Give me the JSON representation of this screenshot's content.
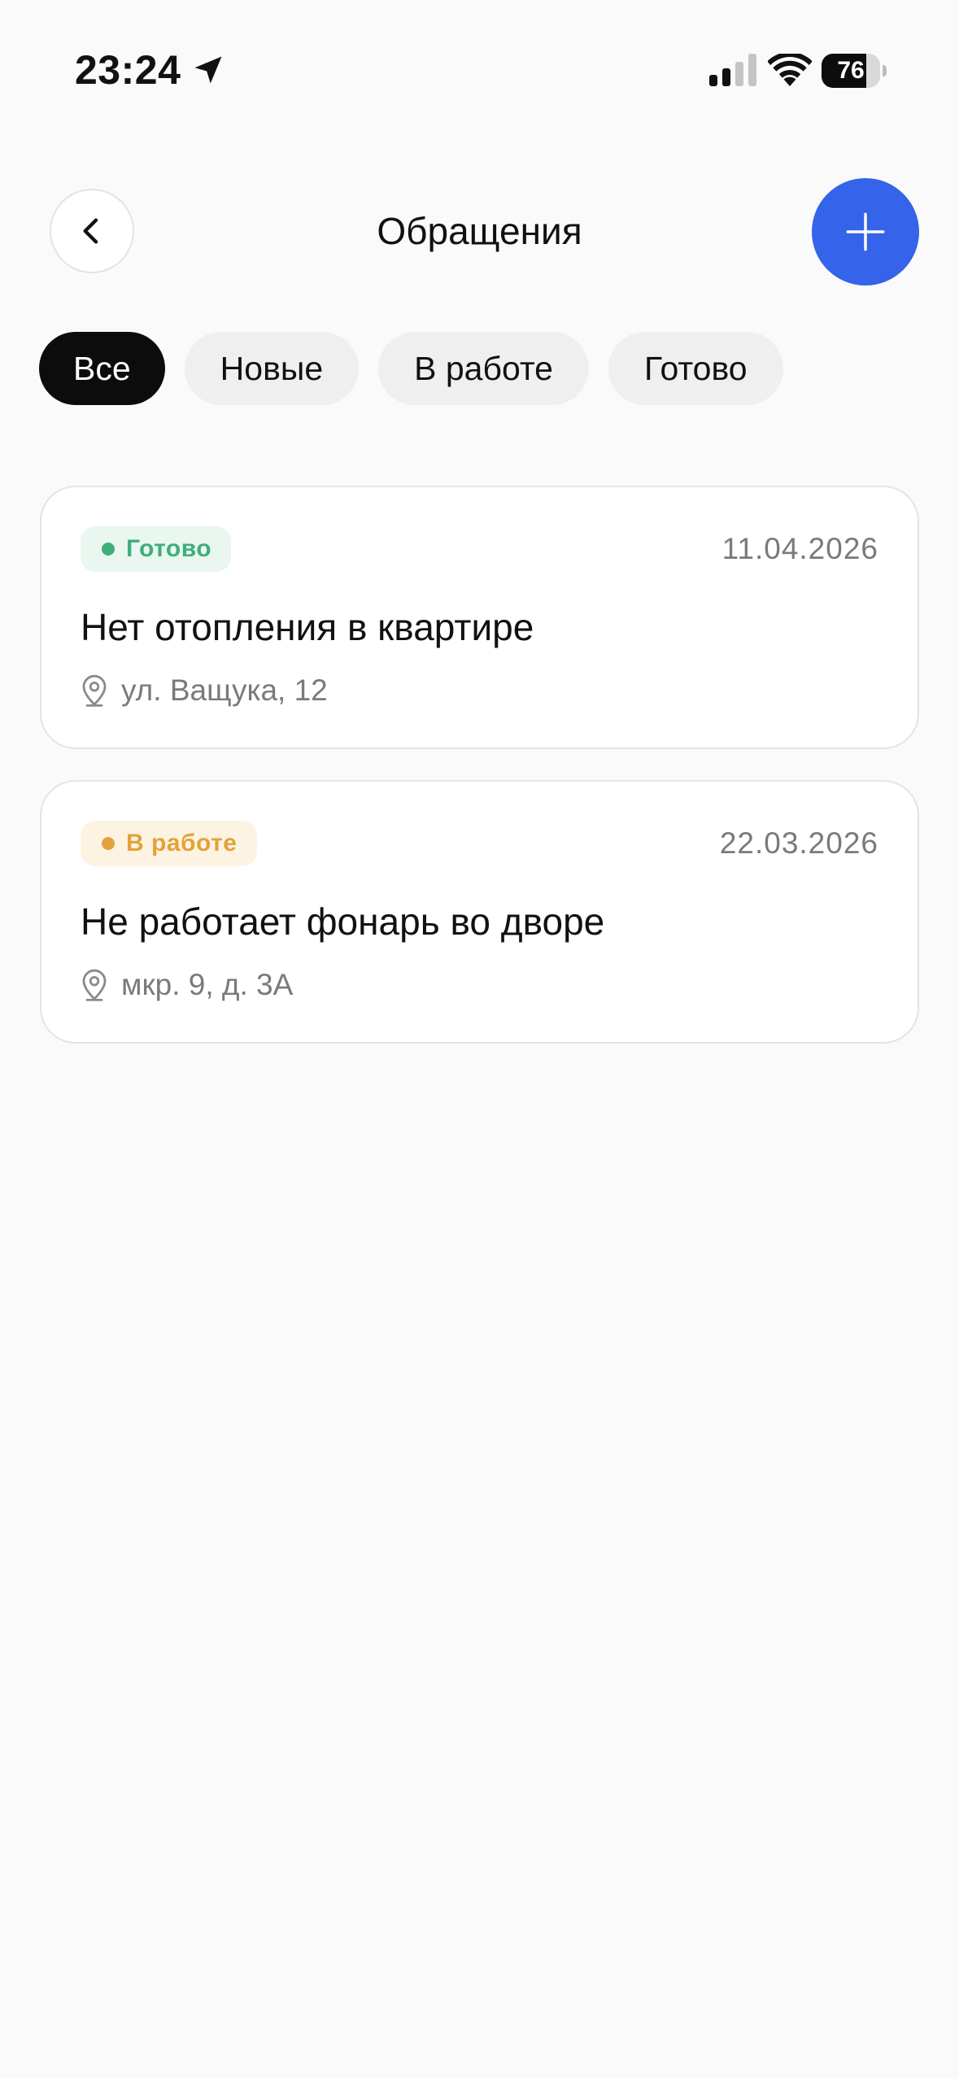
{
  "status_bar": {
    "time": "23:24",
    "battery_percent": "76",
    "battery_level": 0.76,
    "icons": [
      "location-arrow-icon",
      "cellular-signal-icon",
      "wifi-icon",
      "battery-icon"
    ]
  },
  "header": {
    "title": "Обращения",
    "back_icon": "chevron-left-icon",
    "add_icon": "plus-icon",
    "accent_color": "#3563e9"
  },
  "filters": {
    "selected": "Все",
    "items": [
      {
        "label": "Все"
      },
      {
        "label": "Новые"
      },
      {
        "label": "В работе"
      },
      {
        "label": "Готово"
      }
    ]
  },
  "requests": [
    {
      "status": "Готово",
      "status_color": "#3fae7c",
      "date": "11.04.2026",
      "title": "Нет отопления в квартире",
      "address": "ул. Ващука, 12"
    },
    {
      "status": "В работе",
      "status_color": "#e3a23a",
      "date": "22.03.2026",
      "title": "Не работает фонарь во дворе",
      "address": "мкр. 9, д. 3А"
    }
  ]
}
